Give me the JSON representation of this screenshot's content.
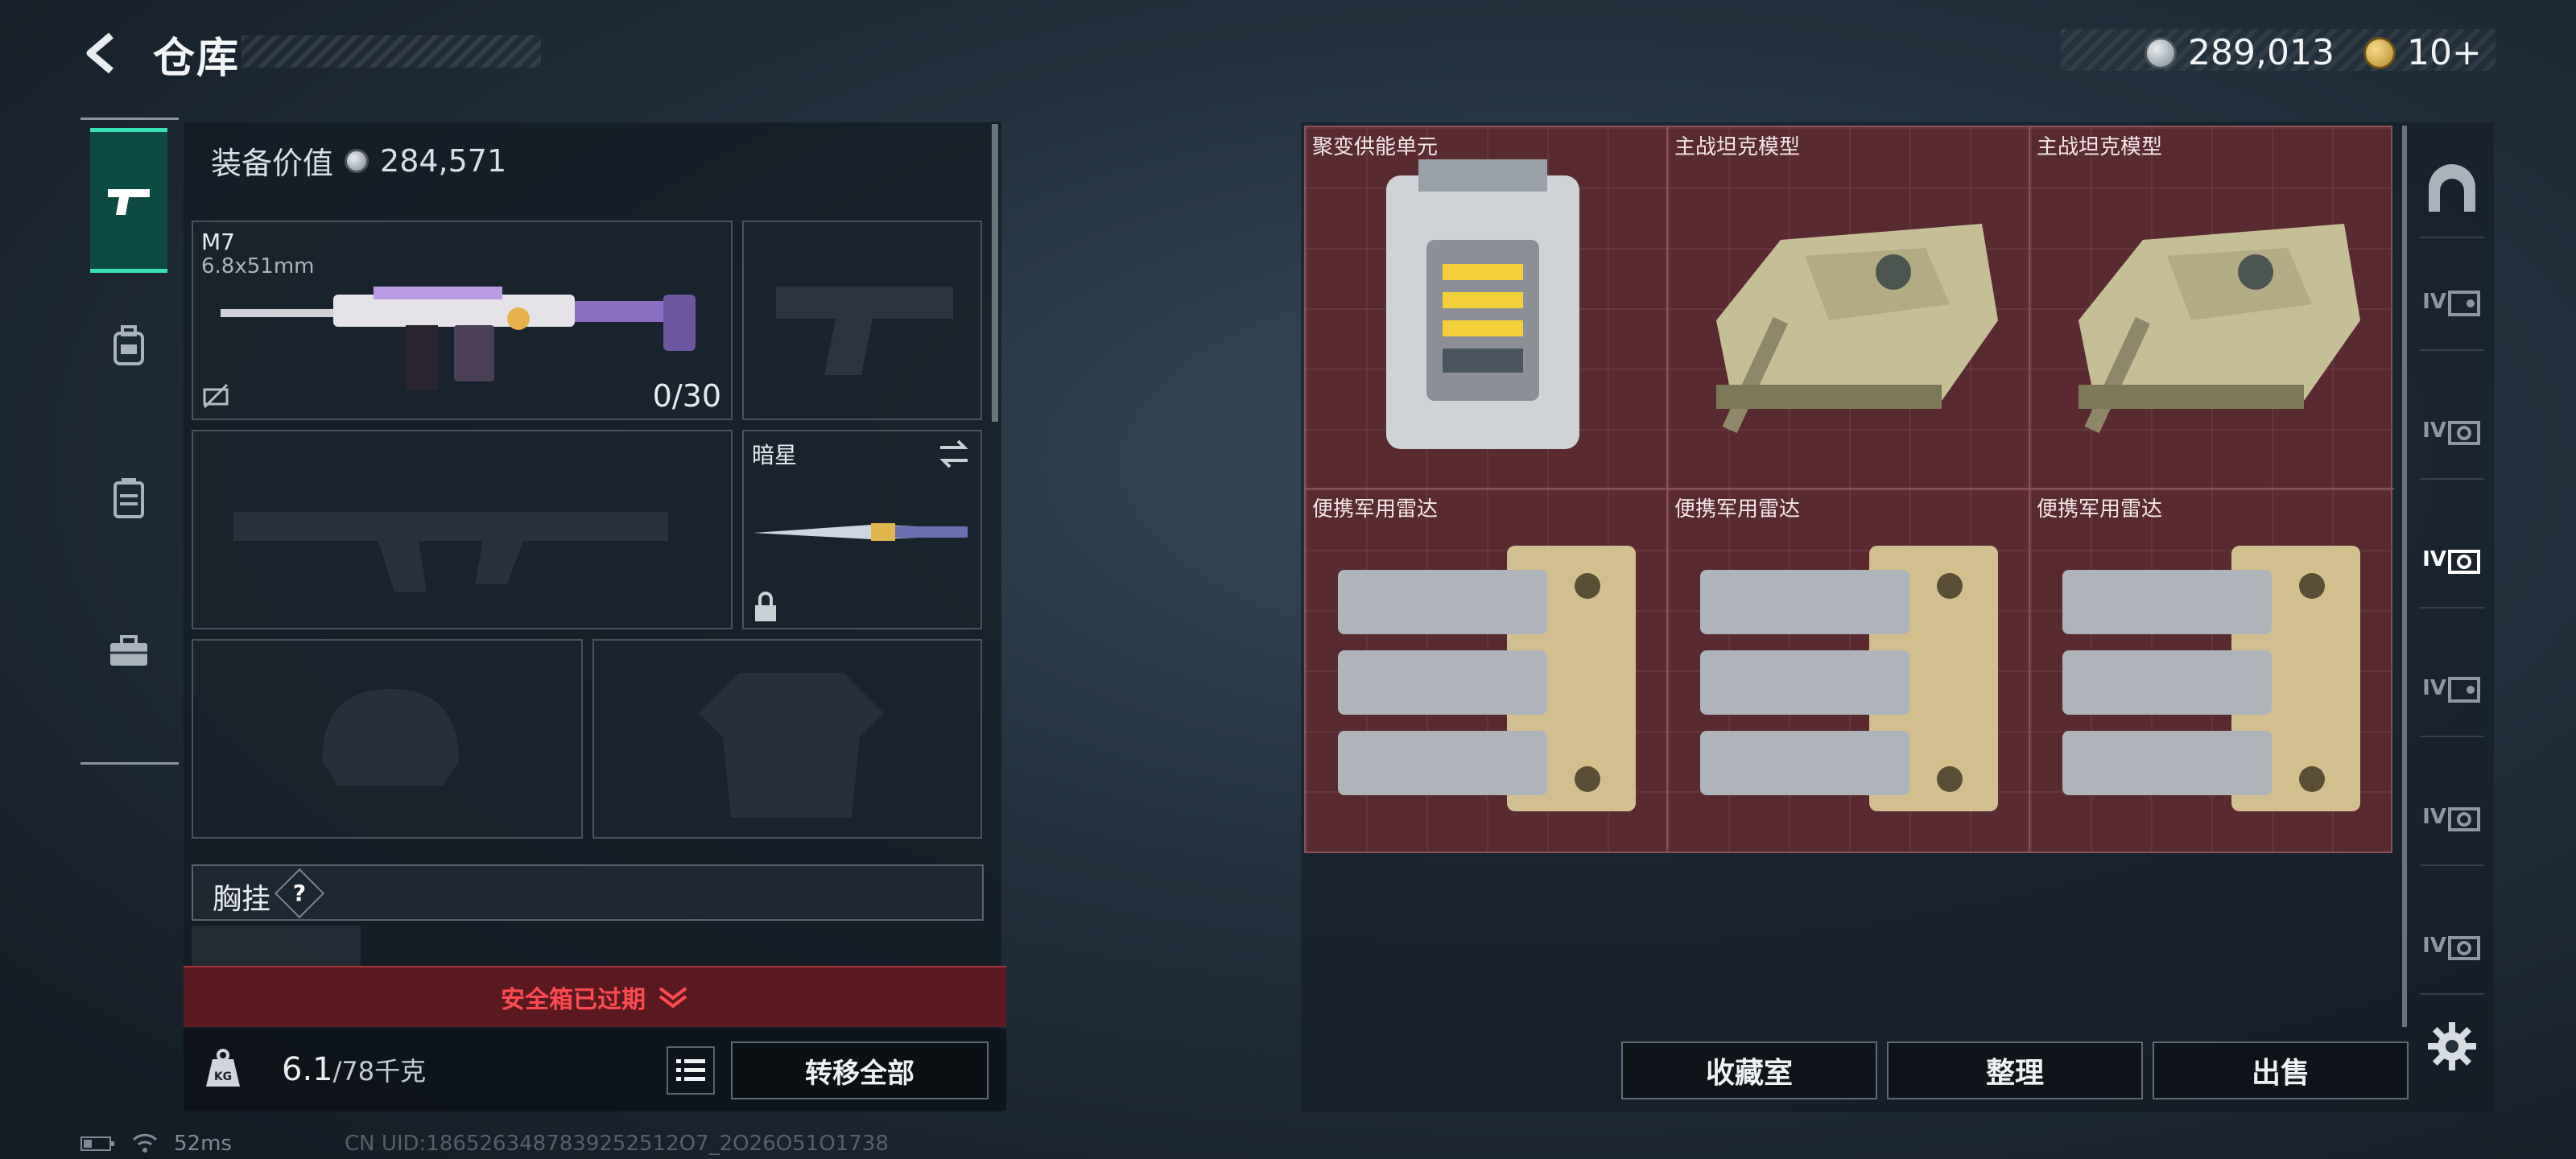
{
  "header": {
    "title": "仓库",
    "currency": {
      "silver_amount": "289,013",
      "gold_amount": "10+"
    }
  },
  "left_nav": {
    "items": [
      {
        "name": "weapons",
        "icon": "pistol-icon",
        "active": true
      },
      {
        "name": "backpack",
        "icon": "backpack-icon",
        "active": false
      },
      {
        "name": "armor",
        "icon": "vest-icon",
        "active": false
      },
      {
        "name": "toolbox",
        "icon": "briefcase-icon",
        "active": false
      }
    ]
  },
  "loadout": {
    "equip_value_label": "装备价值",
    "equip_value": "284,571",
    "primary": {
      "name": "M7",
      "caliber": "6.8x51mm",
      "ammo": "0/30"
    },
    "melee": {
      "name": "暗星"
    },
    "chest_rig_label": "胸挂",
    "help_symbol": "?",
    "safe_box_text": "安全箱已过期",
    "weight_current": "6.1",
    "weight_max": "/78千克",
    "transfer_all": "转移全部",
    "weight_icon_text": "KG"
  },
  "stash": {
    "items": [
      {
        "label": "聚变供能单元",
        "icon": "fusion-cell-icon"
      },
      {
        "label": "主战坦克模型",
        "icon": "tank-model-icon"
      },
      {
        "label": "主战坦克模型",
        "icon": "tank-model-icon"
      },
      {
        "label": "便携军用雷达",
        "icon": "radar-icon"
      },
      {
        "label": "便携军用雷达",
        "icon": "radar-icon"
      },
      {
        "label": "便携军用雷达",
        "icon": "radar-icon"
      }
    ],
    "grid_color": "#5a2a31"
  },
  "right_nav": {
    "tier_label": "IV",
    "items": [
      "home-icon",
      "safe-icon",
      "camera-icon",
      "camera-icon-active",
      "safe-icon",
      "camera-icon",
      "camera-icon"
    ]
  },
  "actions": {
    "collection": "收藏室",
    "organize": "整理",
    "sell": "出售"
  },
  "status": {
    "ping": "52ms",
    "uid": "CN UID:1865263487839252512O7_2O26O51O1738"
  },
  "colors": {
    "accent": "#36e0b9",
    "warning": "#ff4b4f"
  }
}
